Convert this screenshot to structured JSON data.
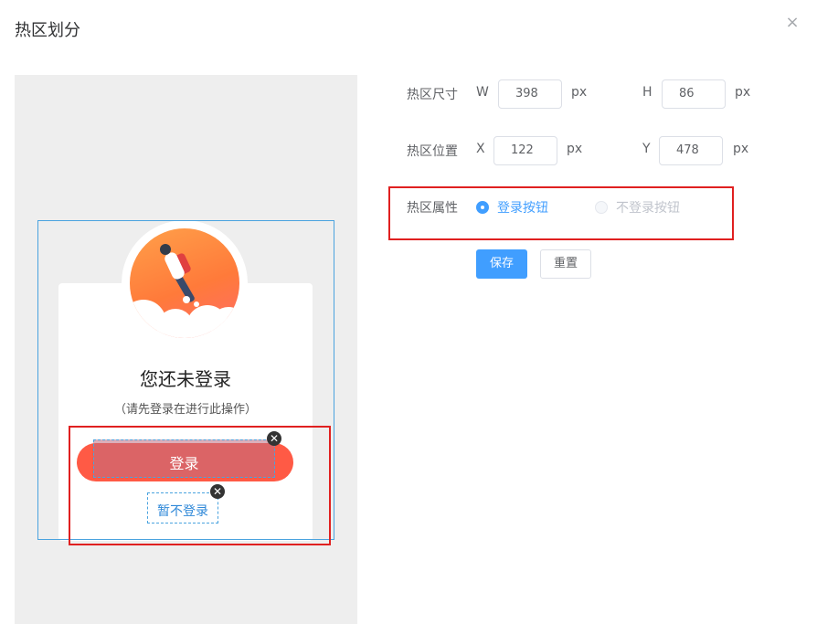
{
  "dialog": {
    "title": "热区划分",
    "close_icon": "×"
  },
  "preview": {
    "heading": "您还未登录",
    "subheading": "（请先登录在进行此操作）",
    "login_button": "登录",
    "skip_button": "暂不登录",
    "delete_icon": "✕"
  },
  "form": {
    "size_label": "热区尺寸",
    "position_label": "热区位置",
    "property_label": "热区属性",
    "w_label": "W",
    "h_label": "H",
    "x_label": "X",
    "y_label": "Y",
    "unit": "px",
    "width_value": "398",
    "height_value": "86",
    "x_value": "122",
    "y_value": "478",
    "property_options": [
      {
        "label": "登录按钮",
        "checked": true,
        "disabled": false
      },
      {
        "label": "不登录按钮",
        "checked": false,
        "disabled": true
      }
    ],
    "save_button": "保存",
    "reset_button": "重置"
  },
  "colors": {
    "primary": "#409eff",
    "highlight_red": "#e02020",
    "login_red": "#ff5a45"
  }
}
